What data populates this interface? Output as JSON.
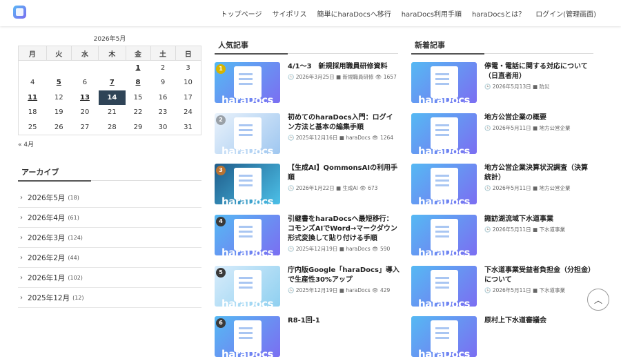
{
  "nav": [
    "トップページ",
    "サイポリス",
    "簡単にharaDocsへ移行",
    "haraDocs利用手順",
    "haraDocsとは？",
    "ログイン(管理画面)"
  ],
  "calendar": {
    "caption": "2026年5月",
    "weekdays": [
      "月",
      "火",
      "水",
      "木",
      "金",
      "土",
      "日"
    ],
    "rows": [
      [
        "",
        "",
        "",
        "",
        "1",
        "2",
        "3"
      ],
      [
        "4",
        "5",
        "6",
        "7",
        "8",
        "9",
        "10"
      ],
      [
        "11",
        "12",
        "13",
        "14",
        "15",
        "16",
        "17"
      ],
      [
        "18",
        "19",
        "20",
        "21",
        "22",
        "23",
        "24"
      ],
      [
        "25",
        "26",
        "27",
        "28",
        "29",
        "30",
        "31"
      ]
    ],
    "linked": [
      "1",
      "5",
      "7",
      "8",
      "11",
      "13"
    ],
    "today": "14",
    "prev": "« 4月"
  },
  "archive": {
    "title": "アーカイブ",
    "items": [
      {
        "label": "2026年5月",
        "count": "(18)"
      },
      {
        "label": "2026年4月",
        "count": "(61)"
      },
      {
        "label": "2026年3月",
        "count": "(124)"
      },
      {
        "label": "2026年2月",
        "count": "(44)"
      },
      {
        "label": "2026年1月",
        "count": "(102)"
      },
      {
        "label": "2025年12月",
        "count": "(12)"
      }
    ]
  },
  "popular": {
    "title": "人気記事",
    "items": [
      {
        "rank": "1",
        "title": "4/1～3　新規採用職員研修資料",
        "meta": "🕒 2026年3月25日  ■ 新規職員研修  👁 1657"
      },
      {
        "rank": "2",
        "title": "初めてのharaDocs入門：ログイン方法と基本の編集手順",
        "meta": "🕒 2025年12月16日  ■ haraDocs  👁 1264"
      },
      {
        "rank": "3",
        "title": "【生成AI】QommonsAIの利用手順",
        "meta": "🕒 2026年1月22日  ■ 生成AI  👁 673"
      },
      {
        "rank": "4",
        "title": "引継書をharaDocsへ最短移行：コモンズAIでWord→マークダウン形式変換して貼り付ける手順",
        "meta": "🕒 2025年12月19日  ■ haraDocs  👁 590"
      },
      {
        "rank": "5",
        "title": "庁内版Google「haraDocs」導入で生産性30%アップ",
        "meta": "🕒 2025年12月19日  ■ haraDocs  👁 429"
      },
      {
        "rank": "6",
        "title": "R8-1回-1",
        "meta": ""
      }
    ]
  },
  "recent": {
    "title": "新着記事",
    "items": [
      {
        "title": "停電・電話に関する対応について（日直者用）",
        "meta": "🕒 2026年5月13日  ■ 防災"
      },
      {
        "title": "地方公営企業の概要",
        "meta": "🕒 2026年5月11日  ■ 地方公営企業"
      },
      {
        "title": "地方公営企業決算状況調査（決算統計）",
        "meta": "🕒 2026年5月11日  ■ 地方公営企業"
      },
      {
        "title": "諏訪湖流域下水道事業",
        "meta": "🕒 2026年5月11日  ■ 下水道事業"
      },
      {
        "title": "下水道事業受益者負担金（分担金）について",
        "meta": "🕒 2026年5月11日  ■ 下水道事業"
      },
      {
        "title": "原村上下水道審議会",
        "meta": ""
      }
    ]
  },
  "thumb_brand": "haraDocs",
  "colors": {
    "today_bg": "#2f4457",
    "thumb_gradient": [
      "#55b9f3",
      "#7b6ef2"
    ]
  }
}
